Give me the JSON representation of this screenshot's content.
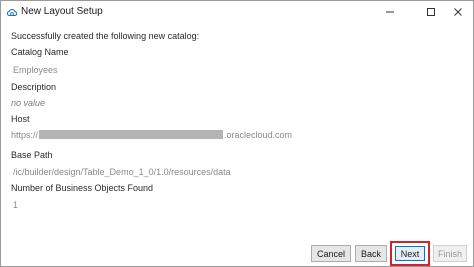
{
  "window": {
    "title": "New Layout Setup"
  },
  "content": {
    "success_message": "Successfully created the following new catalog:",
    "catalog_name_label": "Catalog Name",
    "catalog_name_value": "Employees",
    "description_label": "Description",
    "description_value": "no value",
    "host_label": "Host",
    "host_prefix": "https://",
    "host_suffix": ".oraclecloud.com",
    "base_path_label": "Base Path",
    "base_path_value": "/ic/builder/design/Table_Demo_1_0/1.0/resources/data",
    "objects_found_label": "Number of Business Objects Found",
    "objects_found_value": "1"
  },
  "footer": {
    "cancel_label": "Cancel",
    "back_label": "Back",
    "next_label": "Next",
    "finish_label": "Finish"
  },
  "colors": {
    "highlight_border": "#d3222a",
    "default_button_border": "#0078d7"
  },
  "icons": {
    "app": "cloud-settings-icon",
    "minimize": "minimize-icon",
    "maximize": "maximize-icon",
    "close": "close-icon"
  }
}
